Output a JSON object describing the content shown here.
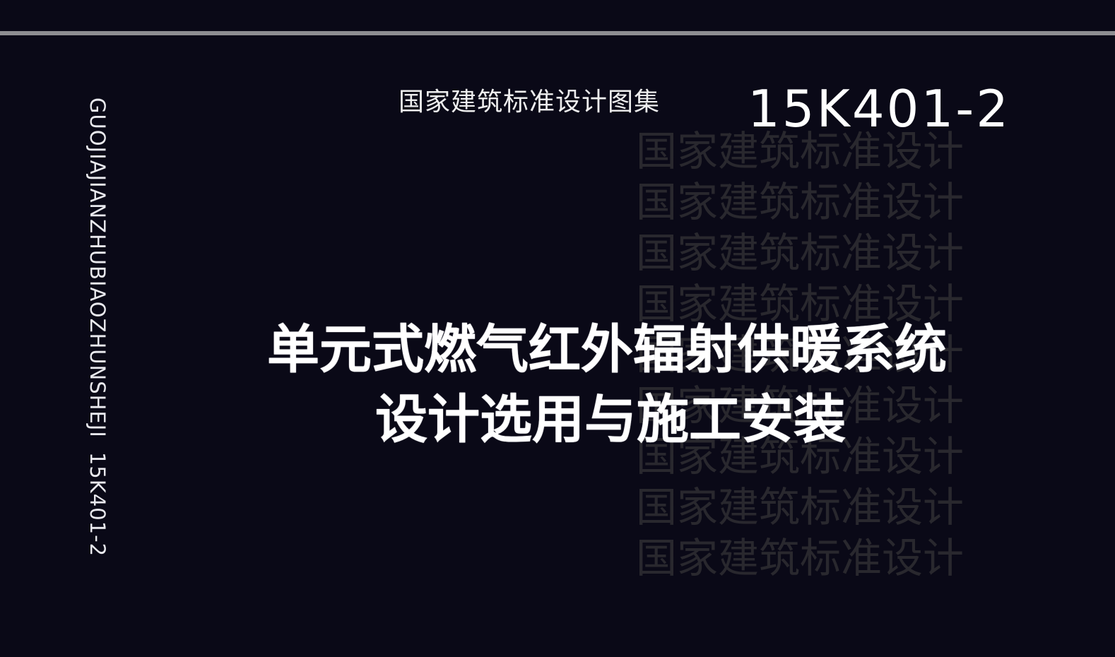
{
  "cover": {
    "background_color": "#0a0917",
    "rule_color": "#8e8e92",
    "series_label": "国家建筑标准设计图集",
    "code": "15K401-2",
    "spine": {
      "pinyin": "GUOJIAJIANZHUBIAOZHUNSHEJI",
      "code": "15K401-2"
    },
    "title": {
      "line1": "单元式燃气红外辐射供暖系统",
      "line2": "设计选用与施工安装"
    },
    "watermark_lines": [
      "国家建筑标准设计",
      "国家建筑标准设计",
      "国家建筑标准设计",
      "国家建筑标准设计",
      "国家建筑标准设计",
      "国家建筑标准设计",
      "国家建筑标准设计",
      "国家建筑标准设计",
      "国家建筑标准设计"
    ]
  }
}
